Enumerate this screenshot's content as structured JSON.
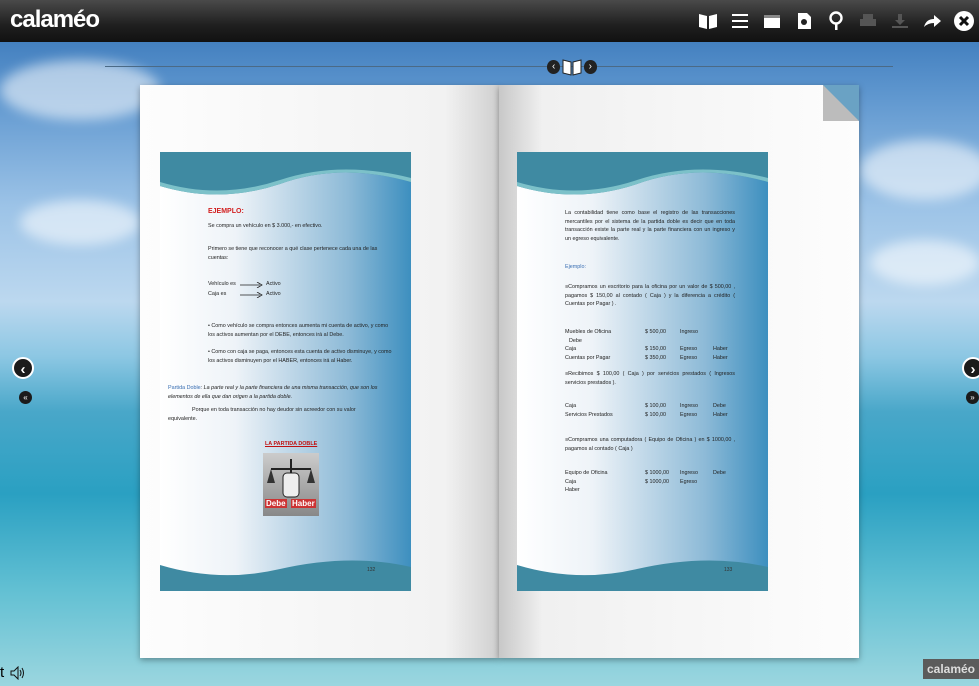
{
  "app": {
    "logo": "calaméo"
  },
  "toolbar": {
    "icons": [
      "book-view-icon",
      "list-icon",
      "fullscreen-icon",
      "document-icon",
      "search-icon",
      "print-icon",
      "download-icon",
      "share-icon",
      "close-icon"
    ]
  },
  "pager": {
    "prev": "‹",
    "next": "›"
  },
  "left_page": {
    "heading": "EJEMPLO:",
    "line1": "Se compra un vehículo en $ 3.000,- en efectivo.",
    "line2": "Primero se tiene que reconocer a qué clase pertenece cada una de las cuentas:",
    "row1_label": "Vehículo es",
    "row1_value": "Activo",
    "row2_label": "Caja es",
    "row2_value": "Activo",
    "bullet1": "• Como vehículo se compra entonces aumenta mi cuenta de activo, y como los activos aumentan por el DEBE, entonces irá al Debe.",
    "bullet2": "• Como con caja se paga, entonces esta cuenta de activo disminuye, y como los activos disminuyen por el HABER, entonces irá al Haber.",
    "partida_label": "Partida Doble",
    "partida_text": ": La parte real y la parte financiera de una misma transacción, que son los elementos de ella que dan origen a la partida doble.",
    "partida_text2": "Porque en toda transacción no hay deudor sin acreedor con su valor equivalente.",
    "figure_title": "LA PARTIDA DOBLE",
    "figure_debe": "Debe",
    "figure_haber": "Haber",
    "page_number": "132"
  },
  "right_page": {
    "intro": "La contabilidad tiene como base el registro de las transacciones mercantiles por el sistema de la partida doble es decir que en toda transacción existe la parte real y la parte financiera con un ingreso y un egreso equivalente.",
    "ejemplo": "Ejemplo:",
    "case1": "≡Compramos un escritorio para la oficina por un valor de $ 500,00 , pagamos $ 150,00 al contado ( Caja ) y la diferencia a crédito ( Cuentas por Pagar ) .",
    "table1": [
      [
        "Muebles de Oficina",
        "$ 500,00",
        "Ingreso",
        ""
      ],
      [
        "Debe",
        "",
        "",
        ""
      ],
      [
        "Caja",
        "$ 150,00",
        "Egreso",
        "Haber"
      ],
      [
        "Cuentas por Pagar",
        "$ 350,00",
        "Egreso",
        "Haber"
      ]
    ],
    "case2": "≡Recibimos $ 100,00 ( Caja ) por servicios prestados ( Ingresos servicios prestados ).",
    "table2": [
      [
        "Caja",
        "$ 100,00",
        "Ingreso",
        "Debe"
      ],
      [
        "Servicios Prestados",
        "$ 100,00",
        "Egreso",
        "Haber"
      ]
    ],
    "case3": "≡Compramos una computadora ( Equipo de Oficina ) en $ 1000,00 , pagamos al contado ( Caja )",
    "table3": [
      [
        "Equipo de Oficina",
        "$ 1000,00",
        "Ingreso",
        "Debe"
      ],
      [
        "Caja",
        "$ 1000,00",
        "Egreso",
        ""
      ],
      [
        "Haber",
        "",
        "",
        ""
      ]
    ],
    "page_number": "133"
  },
  "footer": {
    "logo": "calaméo",
    "left_char": "t"
  },
  "colors": {
    "toolbar": "#1f1f1f",
    "slide_blue": "#3d8fbf",
    "accent_red": "#d21f1f"
  }
}
